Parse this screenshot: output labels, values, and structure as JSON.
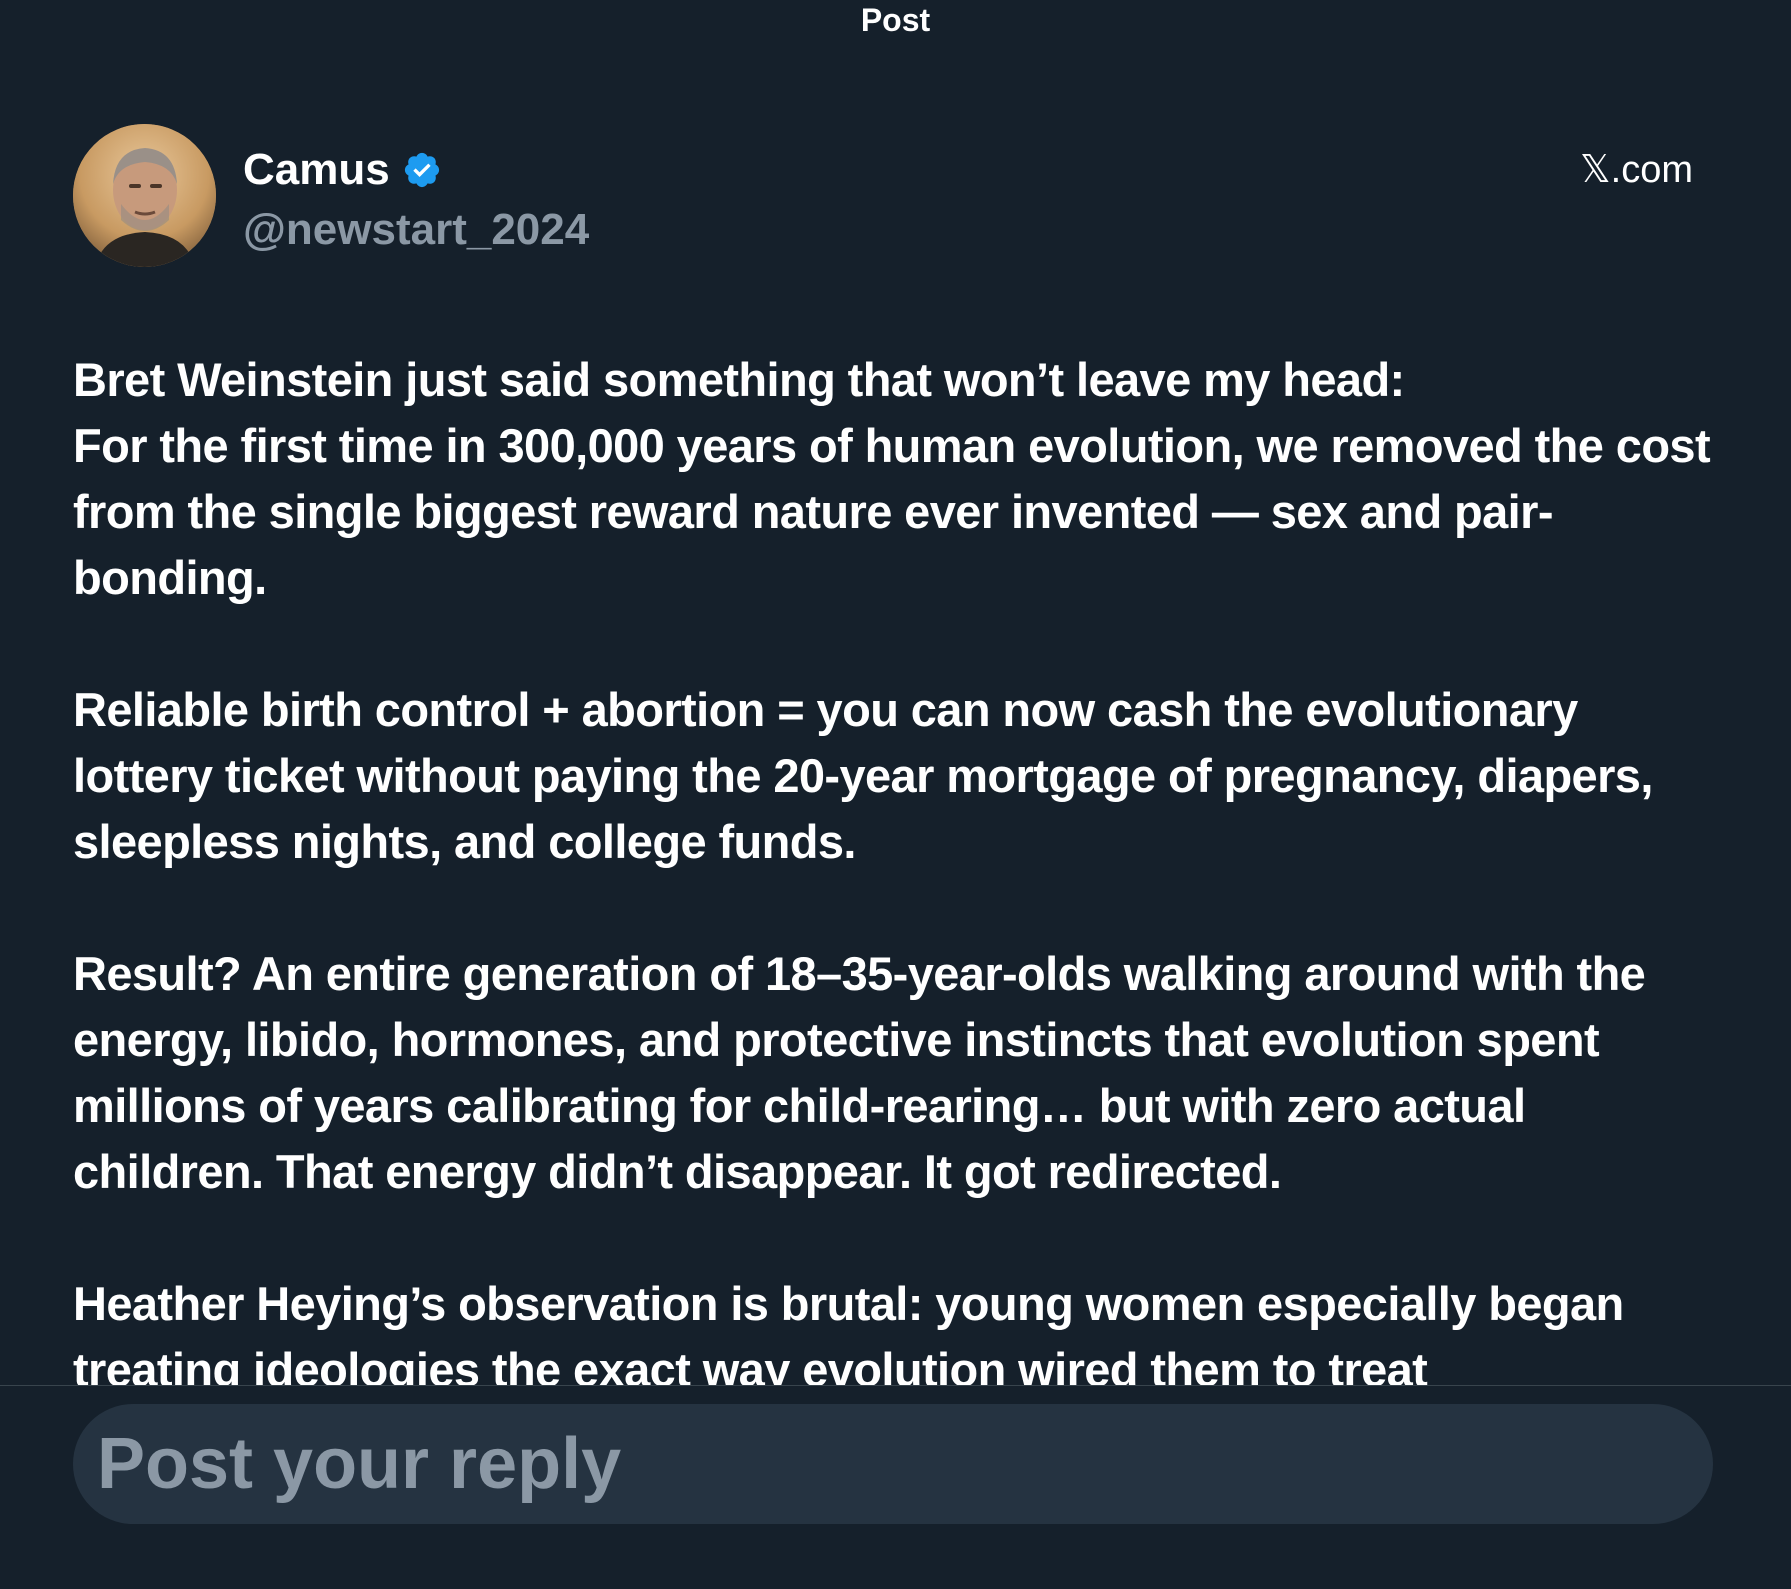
{
  "header": {
    "title": "Post"
  },
  "post": {
    "author": {
      "name": "Camus",
      "handle": "@newstart_2024",
      "verified": true,
      "avatar_icon": "avatar-photo"
    },
    "source": "𝕏.com",
    "paragraphs": [
      "Bret Weinstein just said something that won’t leave my head:\nFor the first time in 300,000 years of human evolution, we removed the cost from the single biggest reward nature ever invented — sex and pair-bonding.",
      "Reliable birth control + abortion = you can now cash the evolutionary lottery ticket without paying the 20-year mortgage of pregnancy, diapers, sleepless nights, and college funds.",
      "Result? An entire generation of 18–35-year-olds walking around with the energy, libido, hormones, and protective instincts that evolution spent millions of years calibrating for child-rearing… but with zero actual children. That energy didn’t disappear. It got redirected.",
      "Heather Heying’s observation is brutal: young women especially began treating ideologies the exact way evolution wired them to treat"
    ]
  },
  "reply": {
    "placeholder": "Post your reply",
    "value": ""
  },
  "colors": {
    "background": "#15202b",
    "text_primary": "#ffffff",
    "text_secondary": "#8b98a5",
    "verified_badge": "#1d9bf0",
    "reply_field": "#253341",
    "divider": "#38444d"
  }
}
